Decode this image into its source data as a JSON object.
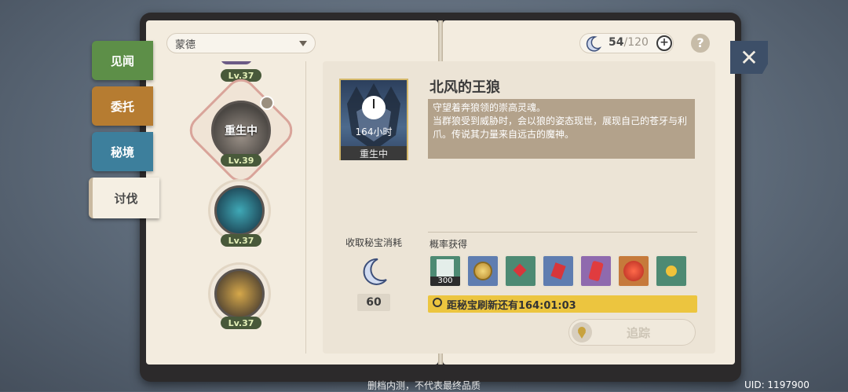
{
  "tabs": [
    "见闻",
    "委托",
    "秘境",
    "讨伐"
  ],
  "region": "蒙德",
  "resin": {
    "current": "54",
    "max": "/120",
    "add": "+",
    "help": "?"
  },
  "close": "✕",
  "list": [
    {
      "level": "Lv.37",
      "icon": "boss-partial-icon"
    },
    {
      "level": "Lv.39",
      "status": "重生中",
      "icon": "wolf-boss-icon",
      "selected": true
    },
    {
      "level": "Lv.37",
      "icon": "cryo-cube-icon"
    },
    {
      "level": "Lv.37",
      "icon": "geo-cube-icon"
    }
  ],
  "boss": {
    "name": "北风的王狼",
    "status": "重生中",
    "hours": "164小时",
    "description": "守望着奔狼领的崇高灵魂。\n当群狼受到威胁时，会以狼的姿态现世，展现自己的苍牙与利爪。传说其力量来自远古的魔神。"
  },
  "cost": {
    "label": "收取秘宝消耗",
    "value": "60"
  },
  "drops": {
    "label": "概率获得",
    "items": [
      {
        "name": "adventure-exp-icon",
        "count": "300",
        "bg": "#4d8a73"
      },
      {
        "name": "mora-coin-icon",
        "bg": "#5f7db0"
      },
      {
        "name": "red-gem-fragment-icon",
        "bg": "#4d8a73"
      },
      {
        "name": "red-gem-sliver-icon",
        "bg": "#5f7db0"
      },
      {
        "name": "red-gem-chunk-icon",
        "bg": "#8f6aae"
      },
      {
        "name": "red-gem-gemstone-icon",
        "bg": "#c67a3b"
      },
      {
        "name": "gold-material-icon",
        "bg": "#4d8a73"
      }
    ]
  },
  "timer": "距秘宝刷新还有164:01:03",
  "track": "追踪",
  "footer": "删档内测，不代表最终品质",
  "uid": "UID: 1197900"
}
